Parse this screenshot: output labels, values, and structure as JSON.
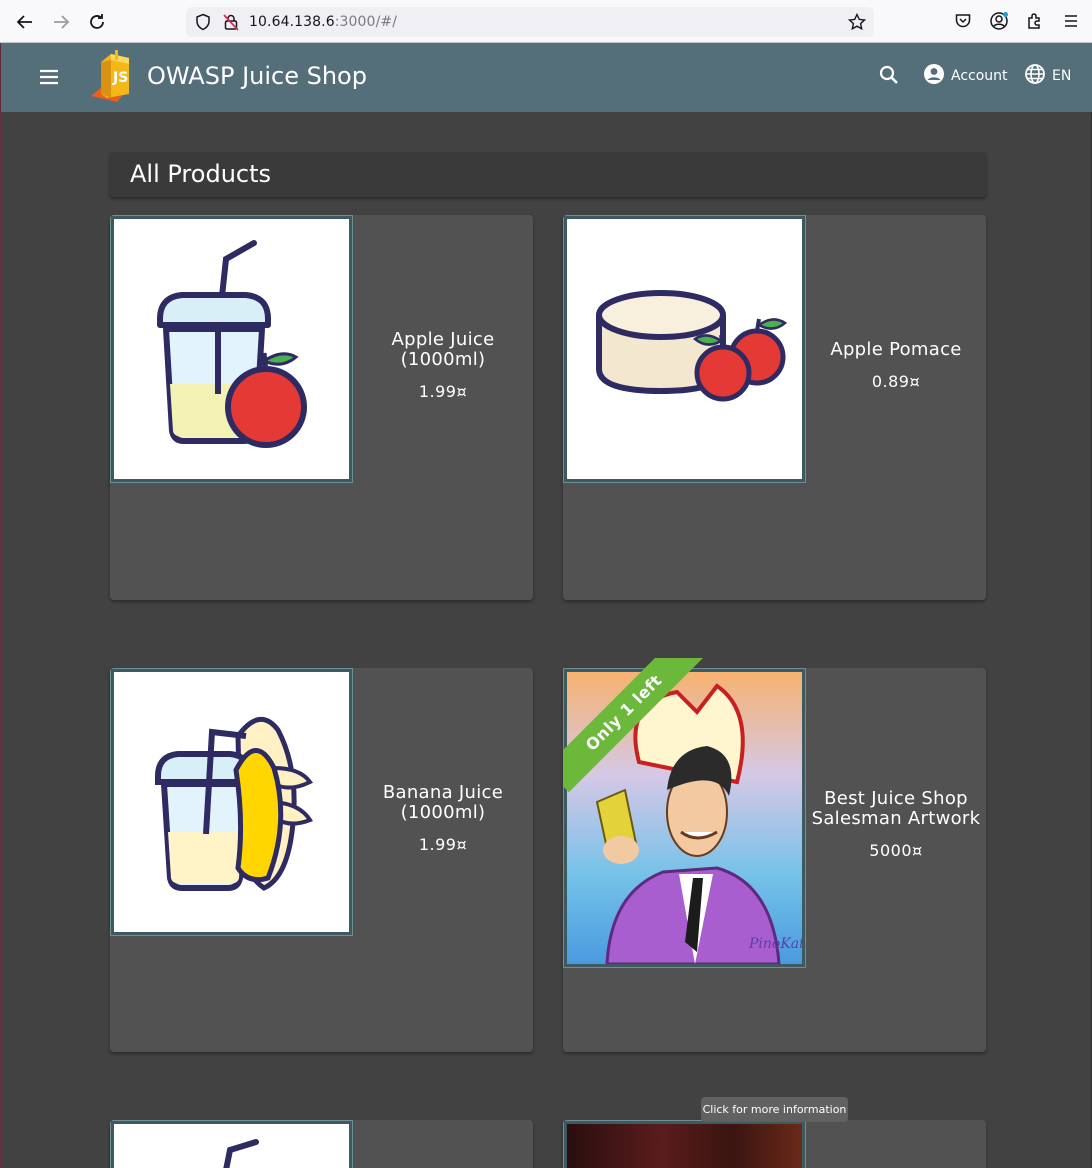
{
  "browser": {
    "url_host": "10.64.138.6",
    "url_rest": ":3000/#/"
  },
  "toolbar": {
    "title": "OWASP Juice Shop",
    "account_label": "Account",
    "language_label": "EN"
  },
  "main": {
    "heading": "All Products",
    "products": [
      {
        "name": "Apple Juice (1000ml)",
        "price": "1.99¤",
        "image_icon": "apple-juice-image"
      },
      {
        "name": "Apple Pomace",
        "price": "0.89¤",
        "image_icon": "apple-pomace-image"
      },
      {
        "name": "Banana Juice (1000ml)",
        "price": "1.99¤",
        "image_icon": "banana-juice-image"
      },
      {
        "name": "Best Juice Shop Salesman Artwork",
        "price": "5000¤",
        "image_icon": "salesman-artwork-image",
        "badge": "Only 1 left"
      }
    ]
  },
  "tooltip": "Click for more information",
  "colors": {
    "toolbar": "#546e7a",
    "background": "#424242",
    "card": "#525252",
    "badge": "#6cb83a"
  }
}
